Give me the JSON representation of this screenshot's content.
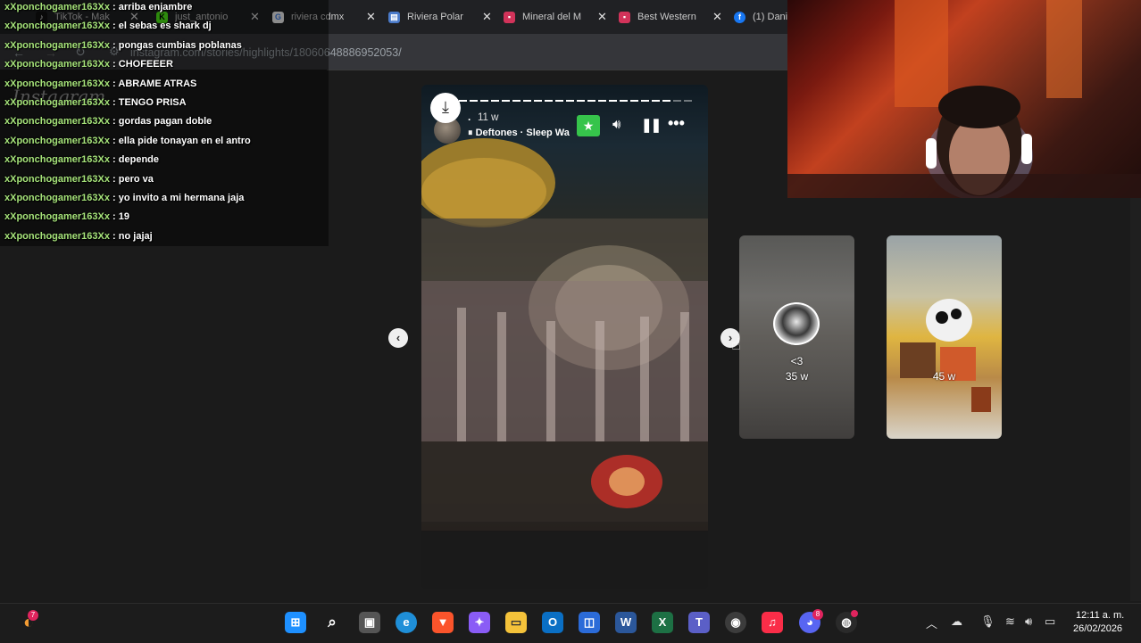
{
  "browser": {
    "tabs": [
      {
        "title": "TikTok - Mak",
        "icon": "tiktok-icon"
      },
      {
        "title": "just_antonio",
        "icon": "kick-icon"
      },
      {
        "title": "riviera cdmx",
        "icon": "google-icon"
      },
      {
        "title": "Riviera Polar",
        "icon": "hotel-icon"
      },
      {
        "title": "Mineral del M",
        "icon": "booking-icon"
      },
      {
        "title": "Best Western",
        "icon": "booking-icon"
      },
      {
        "title": "(1) Dani",
        "icon": "facebook-icon"
      }
    ],
    "address": "instagram.com/stories/highlights/18060648886952053/"
  },
  "chat": {
    "messages": [
      {
        "user": "xXponchogamer163Xx",
        "text": "arriba enjambre"
      },
      {
        "user": "xXponchogamer163Xx",
        "text": "el sebas es shark dj"
      },
      {
        "user": "xXponchogamer163Xx",
        "text": "pongas cumbias poblanas"
      },
      {
        "user": "xXponchogamer163Xx",
        "text": "CHOFEEER"
      },
      {
        "user": "xXponchogamer163Xx",
        "text": "ABRAME ATRAS"
      },
      {
        "user": "xXponchogamer163Xx",
        "text": "TENGO PRISA"
      },
      {
        "user": "xXponchogamer163Xx",
        "text": "gordas pagan doble"
      },
      {
        "user": "xXponchogamer163Xx",
        "text": "ella pide tonayan en el antro"
      },
      {
        "user": "xXponchogamer163Xx",
        "text": "depende"
      },
      {
        "user": "xXponchogamer163Xx",
        "text": "pero va"
      },
      {
        "user": "xXponchogamer163Xx",
        "text": "yo invito a mi hermana jaja"
      },
      {
        "user": "xXponchogamer163Xx",
        "text": "19"
      },
      {
        "user": "xXponchogamer163Xx",
        "text": "no jajaj"
      }
    ]
  },
  "instagram": {
    "logo": "Instagram"
  },
  "story": {
    "username": ".",
    "time": "11 w",
    "music": "Deftones · Sleep Wa",
    "progress_segments": 22,
    "progress_filled": 20
  },
  "thumbnails": [
    {
      "name": "<3",
      "time": "35 w"
    },
    {
      "name": "",
      "time": "45 w"
    }
  ],
  "taskbar": {
    "time": "12:11 a. m.",
    "date": "26/02/2026",
    "badges": {
      "left_app": "7",
      "discord": "8"
    }
  },
  "colors": {
    "chat_user": "#a6e37a",
    "close_friends": "#36c44b"
  }
}
